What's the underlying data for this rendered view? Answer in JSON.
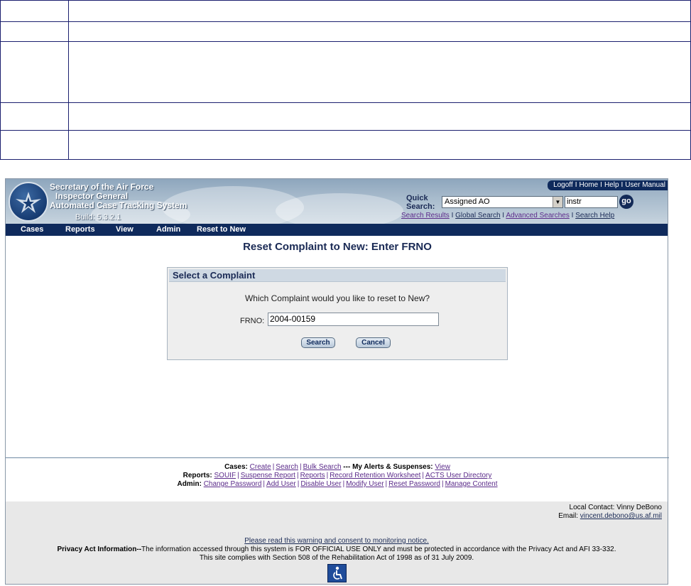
{
  "banner": {
    "line1": "Secretary of the Air Force",
    "line2": "Inspector General",
    "line3": "Automated Case Tracking System",
    "build": "Build: 5.3.2.1",
    "top_links": [
      "Logoff",
      "Home",
      "Help",
      "User Manual"
    ]
  },
  "quick_search": {
    "label_line1": "Quick",
    "label_line2": "Search:",
    "selected": "Assigned AO",
    "input_value": "instr",
    "go_label": "go",
    "links": [
      "Search Results",
      "Global Search",
      "Advanced Searches",
      "Search Help"
    ]
  },
  "nav": [
    "Cases",
    "Reports",
    "View",
    "Admin",
    "Reset to New"
  ],
  "page_title": "Reset Complaint to New: Enter FRNO",
  "form": {
    "heading": "Select a Complaint",
    "question": "Which Complaint would you like to reset to New?",
    "frno_label": "FRNO:",
    "frno_value": "2004-00159",
    "search_button": "Search",
    "cancel_button": "Cancel"
  },
  "footer": {
    "cases_label": "Cases:",
    "cases_links": [
      "Create",
      "Search",
      "Bulk Search"
    ],
    "dashes": "---",
    "alerts_label": "My Alerts & Suspenses:",
    "alerts_link": "View",
    "reports_label": "Reports:",
    "reports_links": [
      "SOUIF",
      "Suspense Report",
      "Reports",
      "Record Retention Worksheet",
      "ACTS User Directory"
    ],
    "admin_label": "Admin:",
    "admin_links": [
      "Change Password",
      "Add User",
      "Disable User",
      "Modify User",
      "Reset Password",
      "Manage Content"
    ]
  },
  "contact": {
    "local": "Local Contact: Vinny DeBono",
    "email_label": "Email:",
    "email": "vincent.debono@us.af.mil"
  },
  "notice": {
    "link": "Please read this warning and consent to monitoring notice.",
    "privacy_label": "Privacy Act Information--",
    "privacy_text": "The information accessed through this system is FOR OFFICIAL USE ONLY and must be protected in accordance with the Privacy Act and AFI 33-332.",
    "section508": "This site complies with Section 508 of the Rehabilitation Act of 1998 as of 31 July 2009."
  },
  "colors": {
    "nav_bg": "#0f2a5c",
    "visited_link": "#5b2b8a",
    "title": "#1a2a55"
  },
  "icons": [
    "air-force-logo-icon",
    "dropdown-arrow-icon",
    "accessibility-icon"
  ]
}
